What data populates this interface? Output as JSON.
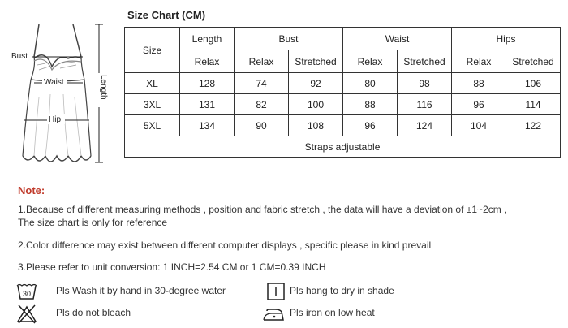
{
  "garment": {
    "bust_label": "Bust",
    "waist_label": "Waist",
    "hip_label": "Hip",
    "length_label": "Length"
  },
  "chart_title": "Size Chart (CM)",
  "table": {
    "size_header": "Size",
    "groups": [
      "Length",
      "Bust",
      "Waist",
      "Hips"
    ],
    "subheaders": [
      "Relax",
      "Relax",
      "Stretched",
      "Relax",
      "Stretched",
      "Relax",
      "Stretched"
    ],
    "rows": [
      {
        "size": "XL",
        "values": [
          "128",
          "74",
          "92",
          "80",
          "98",
          "88",
          "106"
        ]
      },
      {
        "size": "3XL",
        "values": [
          "131",
          "82",
          "100",
          "88",
          "116",
          "96",
          "114"
        ]
      },
      {
        "size": "5XL",
        "values": [
          "134",
          "90",
          "108",
          "96",
          "124",
          "104",
          "122"
        ]
      }
    ],
    "footer": "Straps adjustable"
  },
  "notes": {
    "title": "Note:",
    "line1a": "1.Because of different measuring methods , position and fabric stretch , the data will have a deviation of ±1~2cm ,",
    "line1b": "The size chart is only for reference",
    "line2": "2.Color difference may exist between different computer displays , specific please in kind prevail",
    "line3": "3.Please refer to unit conversion: 1 INCH=2.54 CM or 1 CM=0.39 INCH"
  },
  "care": {
    "wash_temp": "30",
    "wash": "Pls Wash it by hand in 30-degree water",
    "dry": "Pls hang to dry in shade",
    "bleach": "Pls do not bleach",
    "iron": "Pls iron on low heat"
  },
  "colors": {
    "note_title": "#c03a2b",
    "text": "#333333",
    "border": "#333333"
  }
}
